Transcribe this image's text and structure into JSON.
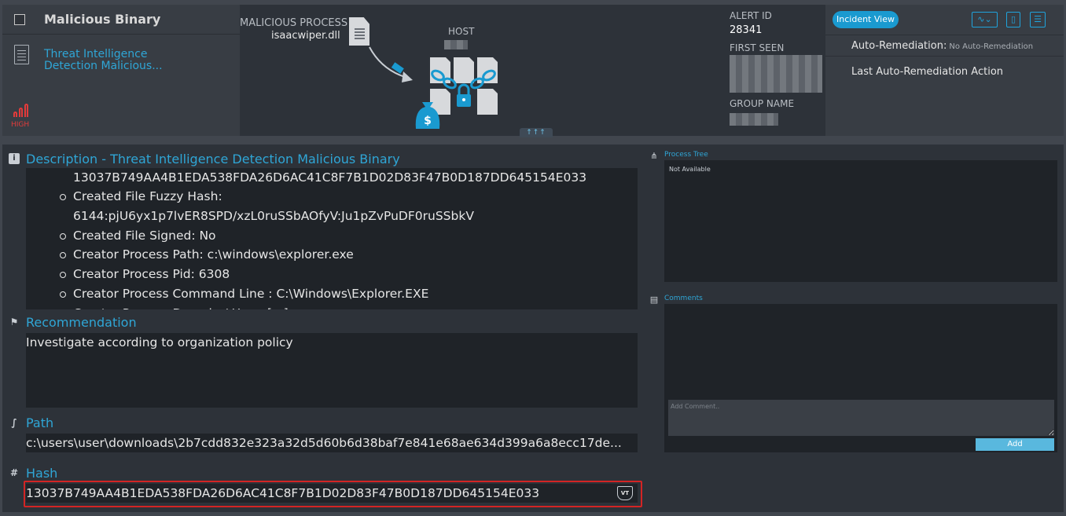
{
  "header": {
    "title": "Malicious Binary",
    "rule_name_line1": "Threat Intelligence",
    "rule_name_line2": "Detection Malicious...",
    "severity": "HIGH",
    "malicious_process_label": "MALICIOUS PROCESS",
    "malicious_process_name": "isaacwiper.dll",
    "host_label": "HOST",
    "collapse_label": "↑↑↑",
    "alert_id_label": "ALERT ID",
    "alert_id": "28341",
    "first_seen_label": "FIRST SEEN",
    "group_name_label": "GROUP NAME",
    "incident_view_button": "Incident View",
    "auto_remediation_label": "Auto-Remediation:",
    "auto_remediation_value": "No Auto-Remediation",
    "last_auto_remediation_label": "Last Auto-Remediation Action",
    "icons": [
      "activity-icon",
      "clipboard-icon",
      "list-icon"
    ]
  },
  "description": {
    "title": "Description - Threat Intelligence Detection Malicious Binary",
    "hash_line": "13037B749AA4B1EDA538FDA26D6AC41C8F7B1D02D83F47B0D187DD645154E033",
    "items": [
      "Created File Fuzzy Hash:",
      "Created File Signed: No",
      "Creator Process Path: c:\\windows\\explorer.exe",
      "Creator Process Pid: 6308",
      "Creator Process Command Line : C:\\Windows\\Explorer.EXE",
      "Creator Process Domain / User: [...]"
    ],
    "fuzzy_hash_value": "6144:pjU6yx1p7lvER8SPD/xzL0ruSSbAOfyV:Ju1pZvPuDF0ruSSbkV"
  },
  "recommendation": {
    "title": "Recommendation",
    "text": "Investigate according to organization policy"
  },
  "path": {
    "title": "Path",
    "value": "c:\\users\\user\\downloads\\2b7cdd832e323a32d5d60b6d38baf7e841e68ae634d399a6a8ecc17de..."
  },
  "hash": {
    "title": "Hash",
    "value": "13037B749AA4B1EDA538FDA26D6AC41C8F7B1D02D83F47B0D187DD645154E033",
    "vt_label": "VT"
  },
  "process_tree": {
    "title": "Process Tree",
    "value": "Not Available"
  },
  "comments": {
    "title": "Comments",
    "placeholder": "Add Comment..",
    "add_button": "Add"
  },
  "colors": {
    "accent": "#2fa6d6",
    "severity_high": "#e23b3b",
    "highlight_border": "#d32424",
    "button": "#1a9ad0"
  }
}
